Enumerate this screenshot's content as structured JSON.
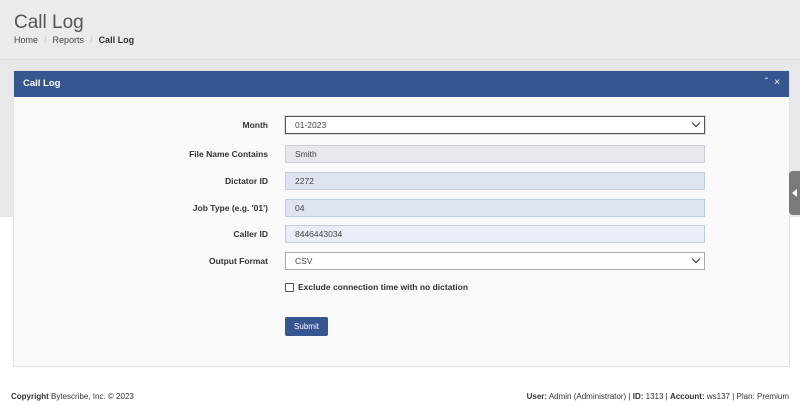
{
  "header": {
    "title": "Call Log",
    "breadcrumb": [
      "Home",
      "Reports",
      "Call Log"
    ]
  },
  "panel": {
    "title": "Call Log",
    "tools": {
      "collapse": "^",
      "close": "x"
    }
  },
  "form": {
    "month": {
      "label": "Month",
      "value": "01-2023"
    },
    "file_name": {
      "label": "File Name Contains",
      "value": "Smith"
    },
    "dictator_id": {
      "label": "Dictator ID",
      "value": "2272"
    },
    "job_type": {
      "label": "Job Type (e.g. '01')",
      "value": "04"
    },
    "caller_id": {
      "label": "Caller ID",
      "value": "8446443034"
    },
    "output_format": {
      "label": "Output Format",
      "value": "CSV"
    },
    "exclude_checkbox_label": "Exclude connection time with no dictation",
    "submit_label": "Submit"
  },
  "footer": {
    "copyright_label": "Copyright",
    "copyright_text": "Bytescribe, Inc. © 2023",
    "user_label": "User:",
    "user_value": "Admin (Administrator)",
    "id_label": "ID:",
    "id_value": "1313",
    "account_label": "Account:",
    "account_value": "ws137",
    "plan_label": "Plan:",
    "plan_value": "Premium"
  },
  "colors": {
    "panel_heading": "#35568f",
    "submit_button": "#35568f",
    "header_bg": "#ebebeb"
  }
}
